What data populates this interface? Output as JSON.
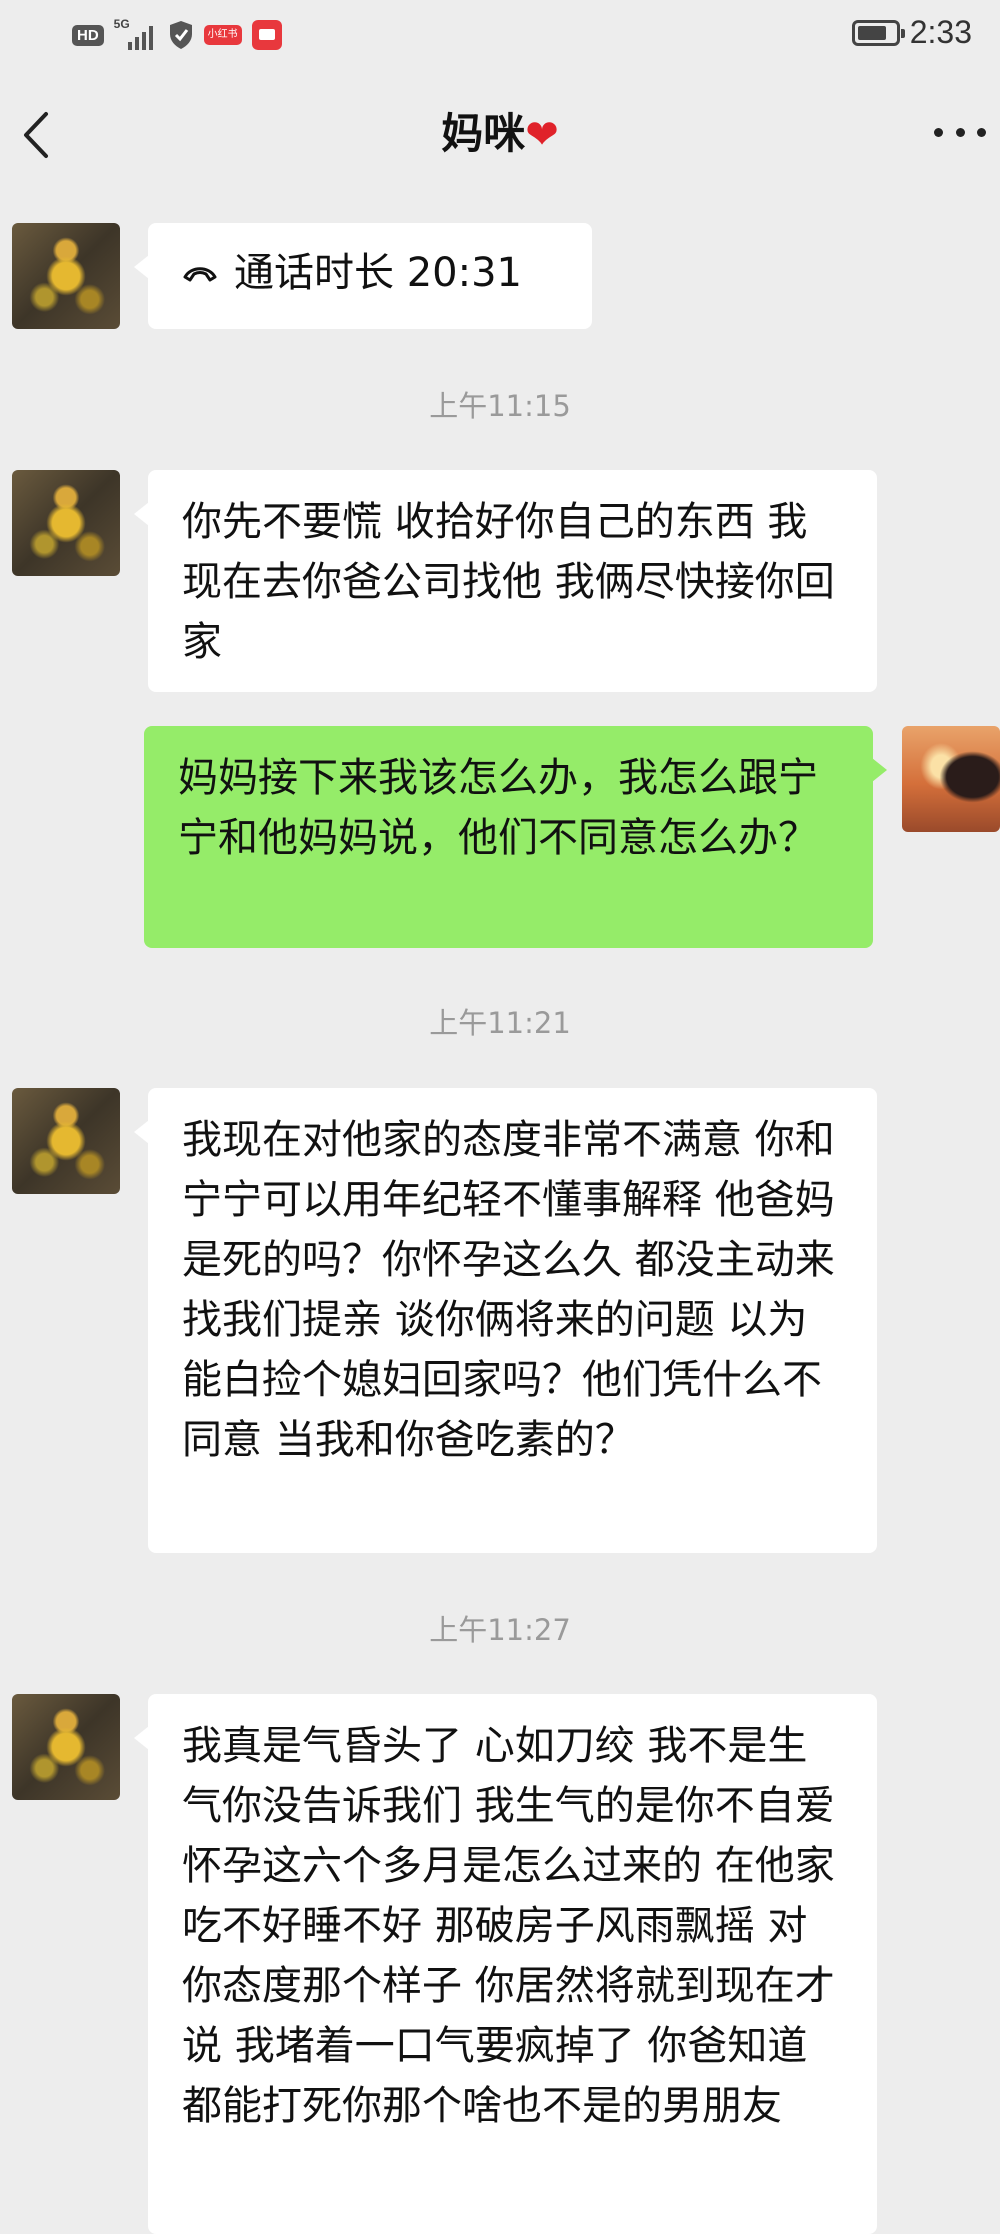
{
  "status_bar": {
    "hd_label": "HD",
    "network_label": "5G",
    "app_badge": "小红书",
    "time": "2:33"
  },
  "nav": {
    "title": "妈咪",
    "title_emoji": "❤",
    "back_icon": "chevron-left-icon",
    "more_icon": "more-icon"
  },
  "messages": [
    {
      "type": "call",
      "from": "other",
      "icon": "phone-hangup-icon",
      "text": "通话时长 20:31"
    },
    {
      "type": "time",
      "text": "上午11:15"
    },
    {
      "type": "text",
      "from": "other",
      "text": "你先不要慌 收拾好你自己的东西 我现在去你爸公司找他 我俩尽快接你回家"
    },
    {
      "type": "text",
      "from": "me",
      "text": "妈妈接下来我该怎么办，我怎么跟宁宁和他妈妈说，他们不同意怎么办？"
    },
    {
      "type": "time",
      "text": "上午11:21"
    },
    {
      "type": "text",
      "from": "other",
      "text": "我现在对他家的态度非常不满意 你和宁宁可以用年纪轻不懂事解释 他爸妈是死的吗？你怀孕这么久 都没主动来找我们提亲 谈你俩将来的问题 以为能白捡个媳妇回家吗？他们凭什么不同意 当我和你爸吃素的？"
    },
    {
      "type": "time",
      "text": "上午11:27"
    },
    {
      "type": "text",
      "from": "other",
      "text": "我真是气昏头了 心如刀绞 我不是生气你没告诉我们 我生气的是你不自爱 怀孕这六个多月是怎么过来的 在他家吃不好睡不好 那破房子风雨飘摇 对你态度那个样子 你居然将就到现在才说 我堵着一口气要疯掉了 你爸知道都能打死你那个啥也不是的男朋友"
    }
  ],
  "colors": {
    "background": "#ededed",
    "bubble_other": "#ffffff",
    "bubble_me": "#95ec69",
    "timestamp": "#9a9a9a"
  }
}
